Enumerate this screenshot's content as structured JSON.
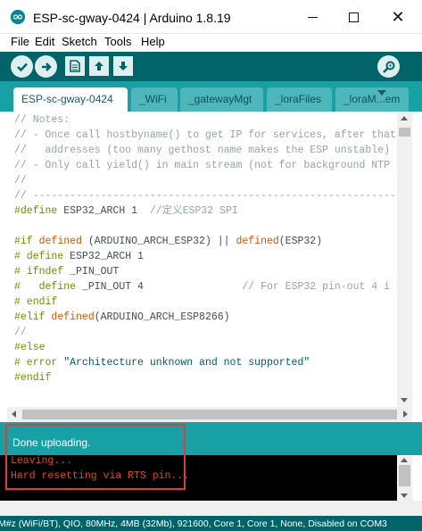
{
  "window": {
    "title": "ESP-sc-gway-0424 | Arduino 1.8.19"
  },
  "menu": [
    "File",
    "Edit",
    "Sketch",
    "Tools",
    "Help"
  ],
  "tabs": [
    {
      "label": "ESP-sc-gway-0424",
      "active": true
    },
    {
      "label": "_WiFi",
      "active": false
    },
    {
      "label": "_gatewayMgt",
      "active": false
    },
    {
      "label": "_loraFiles",
      "active": false
    },
    {
      "label": "_loraM...em",
      "active": false
    }
  ],
  "code_lines": [
    "// Notes:",
    "// - Once call hostbyname() to get IP for services, after that",
    "//   addresses (too many gethost name makes the ESP unstable)",
    "// - Only call yield() in main stream (not for background NTP",
    "//",
    "// ------------------------------------------------------------",
    "#define ESP32_ARCH 1  //定义ESP32 SPI",
    "",
    "#if defined (ARDUINO_ARCH_ESP32) || defined(ESP32)",
    "# define ESP32_ARCH 1",
    "# ifndef _PIN_OUT",
    "#   define _PIN_OUT 4                // For ESP32 pin-out 4 i",
    "# endif",
    "#elif defined(ARDUINO_ARCH_ESP8266)",
    "//",
    "#else",
    "# error \"Architecture unknown and not supported\"",
    "#endif"
  ],
  "status": {
    "message": "Done uploading."
  },
  "console": {
    "lines": [
      "Leaving...",
      "Hard resetting via RTS pin..."
    ]
  },
  "board_status": "M#z (WiFi/BT), QIO, 80MHz, 4MB (32Mb), 921600, Core 1, Core 1, None, Disabled on COM3",
  "colors": {
    "toolbar": "#006468",
    "tabbar": "#17a1a5",
    "console_text": "#e34c00",
    "highlight": "#e53935"
  },
  "icons": {
    "verify": "check-icon",
    "upload": "arrow-right-icon",
    "new": "new-file-icon",
    "open": "arrow-up-icon",
    "save": "arrow-down-icon",
    "serial_monitor": "magnifier-icon"
  }
}
